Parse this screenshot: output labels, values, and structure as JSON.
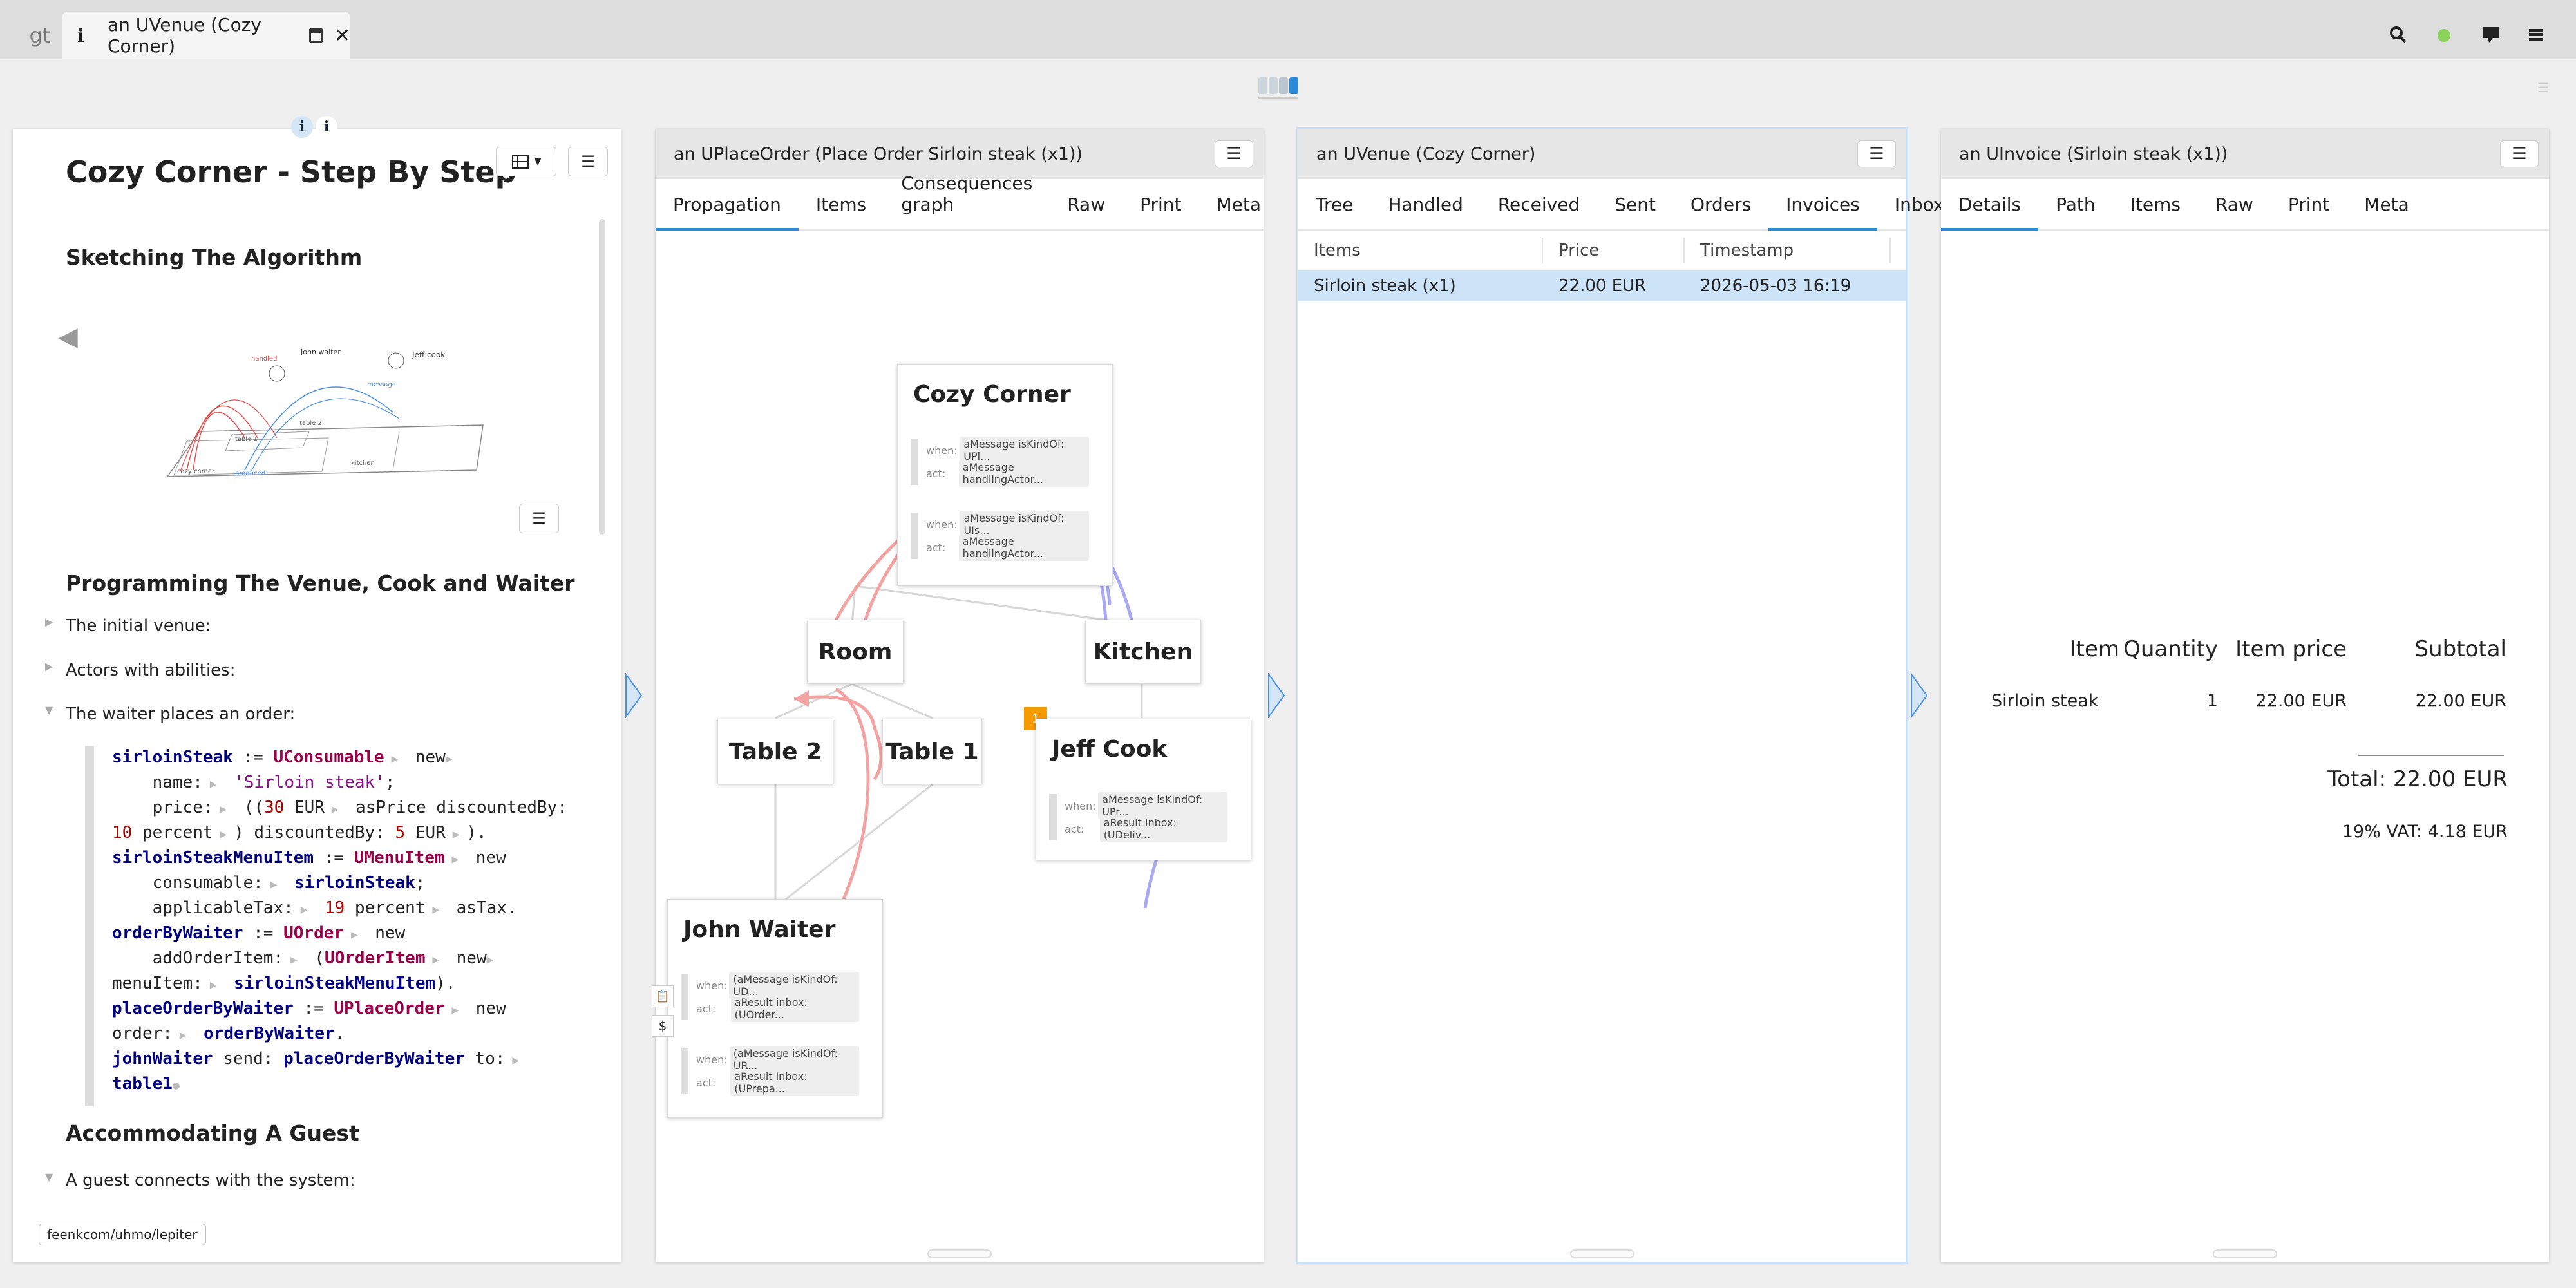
{
  "window": {
    "gt_tab": "gt",
    "active_tab_icon": "i",
    "active_tab_title": "an UVenue (Cozy Corner)",
    "icons": [
      "search-icon",
      "status-dot",
      "comment-icon",
      "menu-icon"
    ]
  },
  "lepiter": {
    "inspect_icon_1": "i",
    "inspect_icon_2": "i",
    "title": "Cozy Corner - Step By Step",
    "h_sketch": "Sketching The Algorithm",
    "h_programming": "Programming The Venue, Cook and Waiter",
    "item_initial": "The initial venue:",
    "item_actors": "Actors with abilities:",
    "item_waiter": "The waiter places an order:",
    "h_accommodating": "Accommodating A Guest",
    "item_guest": "A guest connects with the system:",
    "url": "feenkcom/uhmo/lepiter",
    "sketch_labels": {
      "waiter": "John waiter",
      "cook": "Jeff cook",
      "table2": "table 2",
      "table1": "table 1",
      "cozy": "cozy corner",
      "kitchen": "kitchen",
      "produced": "produced",
      "handled": "handled",
      "message": "message"
    }
  },
  "order_pane": {
    "title": "an UPlaceOrder (Place Order Sirloin steak (x1))",
    "tabs": [
      "Propagation",
      "Items",
      "Consequences graph",
      "Raw",
      "Print",
      "Meta"
    ],
    "active_tab": "Propagation",
    "nodes": {
      "cozy": {
        "title": "Cozy Corner",
        "when1": "aMessage isKindOf: UPl...",
        "act1": "aMessage handlingActor...",
        "when2": "aMessage isKindOf: UIs...",
        "act2": "aMessage handlingActor..."
      },
      "room": {
        "title": "Room"
      },
      "kitchen": {
        "title": "Kitchen"
      },
      "table2": {
        "title": "Table 2"
      },
      "table1": {
        "title": "Table 1"
      },
      "jeff": {
        "title": "Jeff Cook",
        "badge": "1",
        "when1": "aMessage isKindOf: UPr...",
        "act1": "aResult inbox: (UDeliv..."
      },
      "john": {
        "title": "John Waiter",
        "when1": "(aMessage isKindOf: UD...",
        "act1": "aResult inbox: (UOrder...",
        "when2": "(aMessage isKindOf: UR...",
        "act2": "aResult inbox: (UPrepa..."
      }
    },
    "ability_labels": {
      "when": "when:",
      "act": "act:"
    },
    "side_icon_dollar": "$"
  },
  "venue_pane": {
    "title": "an UVenue (Cozy Corner)",
    "tabs": [
      "Tree",
      "Handled",
      "Received",
      "Sent",
      "Orders",
      "Invoices",
      "Inbox"
    ],
    "active_tab": "Invoices",
    "columns": [
      "Items",
      "Price",
      "Timestamp"
    ],
    "rows": [
      {
        "item": "Sirloin steak (x1)",
        "price": "22.00 EUR",
        "timestamp": "2026-05-03 16:19"
      }
    ]
  },
  "invoice_pane": {
    "title": "an UInvoice (Sirloin steak (x1))",
    "tabs": [
      "Details",
      "Path",
      "Items",
      "Raw",
      "Print",
      "Meta"
    ],
    "active_tab": "Details",
    "columns": [
      "Item",
      "Quantity",
      "Item price",
      "Subtotal"
    ],
    "row": {
      "item": "Sirloin steak",
      "quantity": "1",
      "price": "22.00 EUR",
      "subtotal": "22.00 EUR"
    },
    "total": "Total: 22.00 EUR",
    "vat": "19% VAT: 4.18 EUR"
  },
  "colors": {
    "accent": "#2d8ad8",
    "selection": "#cde3f8",
    "propagation_red": "#f4a3a3",
    "propagation_blue": "#a9a9f2",
    "badge": "#f59a00"
  }
}
